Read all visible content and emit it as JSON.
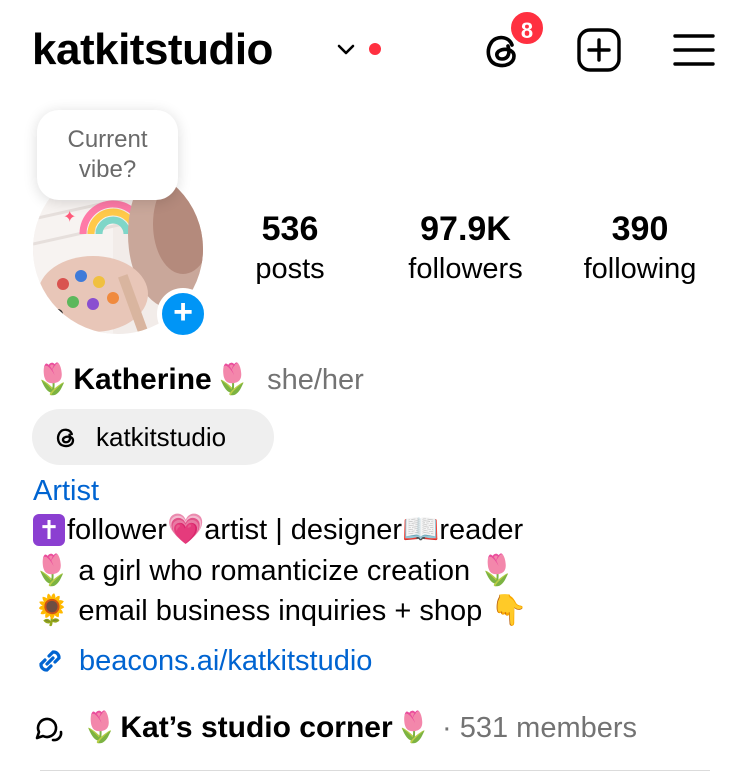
{
  "header": {
    "username": "katkitstudio",
    "threads_badge_count": "8",
    "icons": [
      "chevron-down-icon",
      "threads-icon",
      "plus-square-icon",
      "menu-icon"
    ],
    "accent_red": "#ff3040"
  },
  "profile": {
    "vibe_note": "Current vibe?",
    "avatar_add": "+",
    "stats": {
      "posts": {
        "value": "536",
        "label": "posts"
      },
      "followers": {
        "value": "97.9K",
        "label": "followers"
      },
      "following": {
        "value": "390",
        "label": "following"
      }
    },
    "display_name": "Katherine",
    "name_emoji": "🌷",
    "pronouns": "she/her",
    "threads_handle": "katkitstudio",
    "category": "Artist",
    "bio": {
      "line1": {
        "cross": "✝",
        "t1": "follower ",
        "heart": "💗",
        "t2": "artist | designer ",
        "book": "📖",
        "t3": "reader"
      },
      "line2": {
        "tulip_a": "🌷",
        "text": " a girl who romanticize creation ",
        "tulip_b": "🌷"
      },
      "line3": {
        "sunflower": "🌻",
        "text": " email business inquiries + shop ",
        "point": "👇"
      }
    },
    "link": "beacons.ai/katkitstudio",
    "community": {
      "tulip_a": "🌷",
      "name": "Kat’s studio corner",
      "tulip_b": "🌷",
      "members": "· 531 members"
    },
    "colors": {
      "link_blue": "#0064d1",
      "add_blue": "#0095f6",
      "muted_gray": "#737373"
    }
  }
}
